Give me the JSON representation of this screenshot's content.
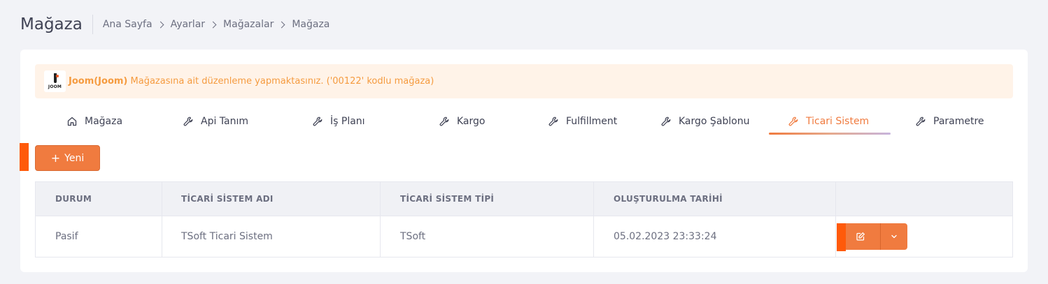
{
  "header": {
    "title": "Mağaza",
    "breadcrumb": [
      "Ana Sayfa",
      "Ayarlar",
      "Mağazalar",
      "Mağaza"
    ]
  },
  "alert": {
    "logo_text": "JOOM",
    "store_name": "Joom(Joom)",
    "message": " Mağazasına ait düzenleme yapmaktasınız. ('00122' kodlu mağaza)"
  },
  "tabs": [
    {
      "label": "Mağaza",
      "icon": "home-icon"
    },
    {
      "label": "Api Tanım",
      "icon": "wrench-icon"
    },
    {
      "label": "İş Planı",
      "icon": "wrench-icon"
    },
    {
      "label": "Kargo",
      "icon": "wrench-icon"
    },
    {
      "label": "Fulfillment",
      "icon": "wrench-icon"
    },
    {
      "label": "Kargo Şablonu",
      "icon": "wrench-icon"
    },
    {
      "label": "Ticari Sistem",
      "icon": "wrench-icon",
      "active": true
    },
    {
      "label": "Parametre",
      "icon": "wrench-icon"
    }
  ],
  "toolbar": {
    "new_label": "Yeni"
  },
  "table": {
    "columns": [
      "DURUM",
      "TİCARİ SİSTEM ADI",
      "TİCARİ SİSTEM TİPİ",
      "OLUŞTURULMA TARİHİ",
      ""
    ],
    "rows": [
      [
        "Pasif",
        "TSoft Ticari Sistem",
        "TSoft",
        "05.02.2023 23:33:24"
      ]
    ]
  },
  "colors": {
    "accent": "#f07b3f",
    "marker": "#ff5a0a",
    "alert_bg": "#fff3e8",
    "alert_text": "#f59b3f"
  }
}
